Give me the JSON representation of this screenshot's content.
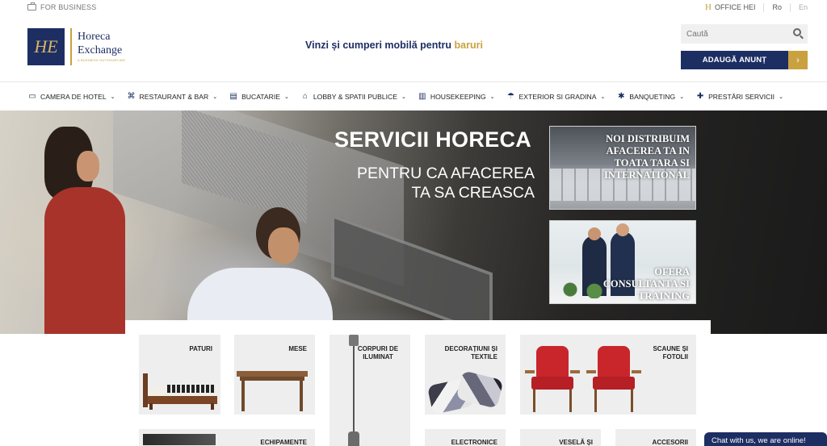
{
  "topbar": {
    "business_label": "FOR BUSINESS",
    "office_label": "OFFICE HEI",
    "office_logo": "H",
    "lang_ro": "Ro",
    "lang_en": "En"
  },
  "header": {
    "logo_monogram": "HE",
    "logo_line1": "Horeca",
    "logo_line2": "Exchange",
    "logo_tagline": "A BUSINESS OUTSOURCING",
    "tagline_main": "Vinzi și cumperi mobilă pentru ",
    "tagline_highlight": "baruri",
    "search_placeholder": "Caută",
    "cta_label": "ADAUGĂ ANUNȚ",
    "cta_arrow": "›"
  },
  "nav": [
    {
      "label": "CAMERA DE HOTEL",
      "icon": "bed-icon",
      "glyph": "▭"
    },
    {
      "label": "RESTAURANT & BAR",
      "icon": "cutlery-icon",
      "glyph": "⌘"
    },
    {
      "label": "BUCATARIE",
      "icon": "stove-icon",
      "glyph": "▤"
    },
    {
      "label": "LOBBY & SPATII PUBLICE",
      "icon": "bell-icon",
      "glyph": "⌂"
    },
    {
      "label": "HOUSEKEEPING",
      "icon": "cart-icon",
      "glyph": "▥"
    },
    {
      "label": "EXTERIOR SI GRADINA",
      "icon": "umbrella-icon",
      "glyph": "☂"
    },
    {
      "label": "BANQUETING",
      "icon": "flower-icon",
      "glyph": "✱"
    },
    {
      "label": "PRESTĂRI SERVICII",
      "icon": "handshake-icon",
      "glyph": "✚"
    }
  ],
  "hero": {
    "title": "SERVICII HORECA",
    "subtitle": "PENTRU CA AFACEREA TA SA CREASCA",
    "promo1": "NOI DISTRIBUIM AFACEREA TA IN TOATA TARA SI INTERNATIONAL",
    "promo2": "OFERA CONSULTANTA SI TRAINING"
  },
  "categories": {
    "paturi": "PATURI",
    "mese": "MESE",
    "corpuri": "CORPURI DE ILUMINAT",
    "decoratiuni": "DECORAȚIUNI ȘI TEXTILE",
    "scaune": "SCAUNE ȘI FOTOLII",
    "echipamente": "ECHIPAMENTE",
    "electronice": "ELECTRONICE",
    "vesela": "VESELĂ ȘI",
    "accesorii": "ACCESORII"
  },
  "chat": {
    "label": "Chat with us, we are online!"
  },
  "colors": {
    "navy": "#1d2e63",
    "gold": "#c9a23f"
  }
}
